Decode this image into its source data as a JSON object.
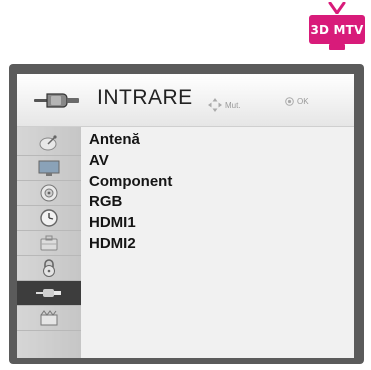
{
  "badge": {
    "label": "3D MTV"
  },
  "header": {
    "title": "INTRARE",
    "hint_move": "Mut.",
    "hint_ok": "OK"
  },
  "sidebar": {
    "icons": [
      "satellite-dish-icon",
      "picture-icon",
      "audio-icon",
      "clock-icon",
      "settings-icon",
      "lock-icon",
      "input-icon",
      "support-icon"
    ],
    "active_index": 6
  },
  "options": [
    "Antenă",
    "AV",
    "Component",
    "RGB",
    "HDMI1",
    "HDMI2"
  ],
  "colors": {
    "badge": "#d81b7a",
    "frame": "#5b5b5b",
    "active_icon_bg": "#3d3d3d"
  }
}
